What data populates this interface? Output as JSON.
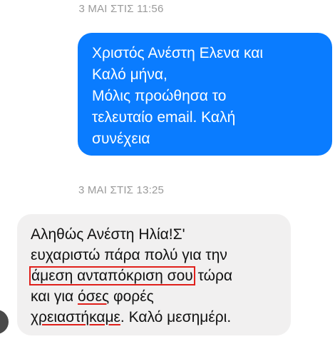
{
  "conversation": {
    "timestamp_1": "3 ΜΑΙ ΣΤΙΣ 11:56",
    "outgoing": {
      "lines": [
        "Χριστός Ανέστη Ελενα και",
        "Καλό μήνα,",
        "Μόλις προώθησα το",
        "τελευταίο email. Καλή",
        "συνέχεια"
      ],
      "color": "#0a7cff"
    },
    "timestamp_2": "3 ΜΑΙ ΣΤΙΣ 13:25",
    "incoming": {
      "line1": "Αληθώς Ανέστη Ηλία!Σ'",
      "line2": "ευχαριστώ πάρα πολύ για την",
      "line3_boxed": "άμεση ανταπόκριση σου",
      "line3_rest": " τώρα",
      "line4_pre": "και για ",
      "line4_underlined": "όσες",
      "line4_post": " φορές",
      "line5_underlined": "χρειαστήκαμε",
      "line5_post": ". Καλό μεσημέρι.",
      "color": "#f1f0f0"
    },
    "annotation_color": "#e0201b"
  }
}
